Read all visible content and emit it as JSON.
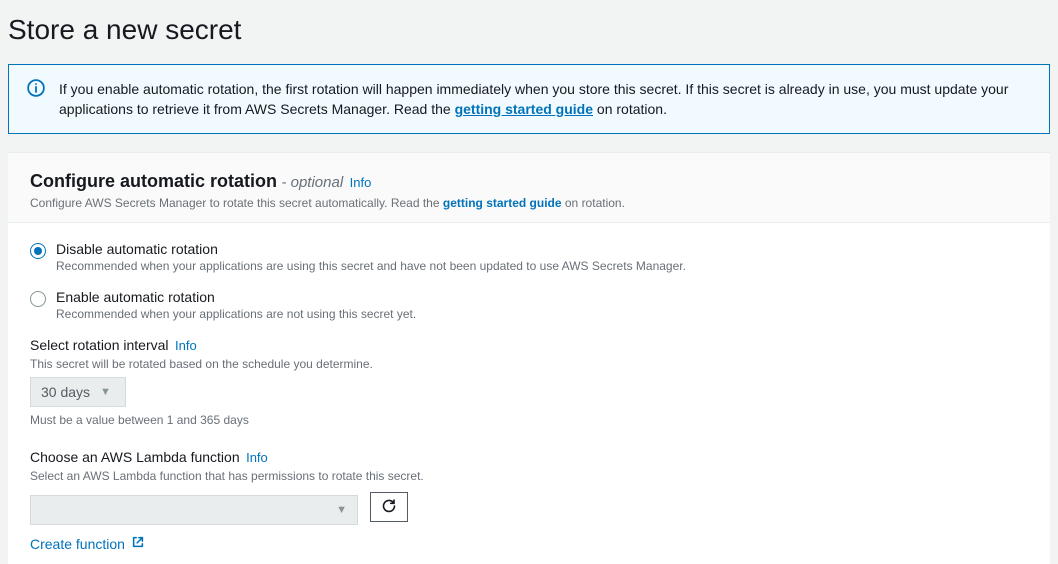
{
  "page": {
    "title": "Store a new secret"
  },
  "alert": {
    "text_before_link": "If you enable automatic rotation, the first rotation will happen immediately when you store this secret. If this secret is already in use, you must update your applications to retrieve it from AWS Secrets Manager. Read the ",
    "link_text": "getting started guide",
    "text_after_link": " on rotation."
  },
  "config_section": {
    "heading": "Configure automatic rotation",
    "optional_suffix": "- optional",
    "info_label": "Info",
    "desc_before": "Configure AWS Secrets Manager to rotate this secret automatically. Read the ",
    "desc_link": "getting started guide",
    "desc_after": " on rotation."
  },
  "rotation_options": {
    "disable": {
      "label": "Disable automatic rotation",
      "desc": "Recommended when your applications are using this secret and have not been updated to use AWS Secrets Manager.",
      "selected": true
    },
    "enable": {
      "label": "Enable automatic rotation",
      "desc": "Recommended when your applications are not using this secret yet.",
      "selected": false
    }
  },
  "interval": {
    "label": "Select rotation interval",
    "info_label": "Info",
    "desc": "This secret will be rotated based on the schedule you determine.",
    "value": "30 days",
    "constraint": "Must be a value between 1 and 365 days"
  },
  "lambda": {
    "label": "Choose an AWS Lambda function",
    "info_label": "Info",
    "desc": "Select an AWS Lambda function that has permissions to rotate this secret.",
    "value": "",
    "create_link": "Create function"
  }
}
